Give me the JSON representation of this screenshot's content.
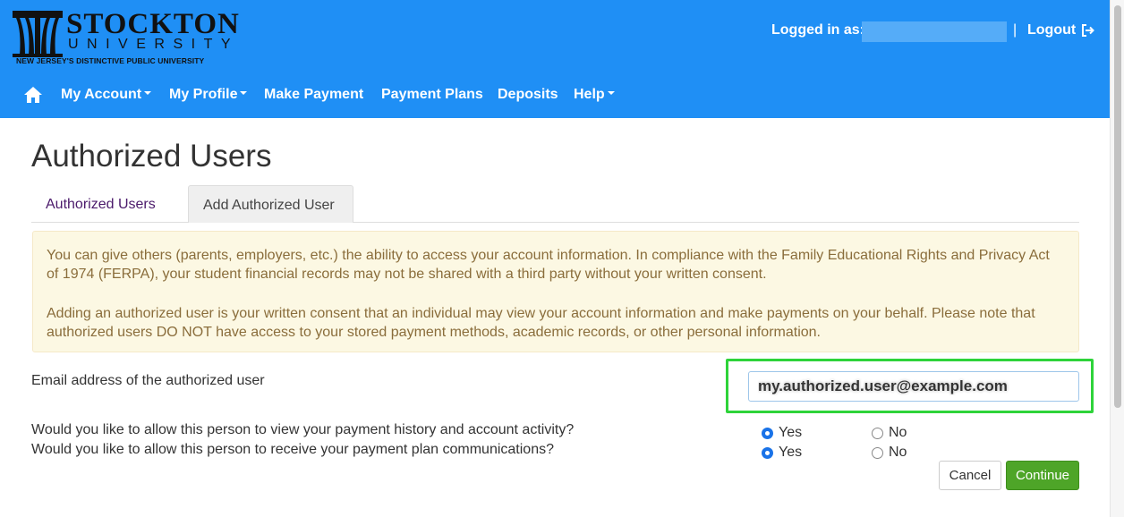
{
  "brand": {
    "name": "STOCKTON",
    "sub": "UNIVERSITY",
    "tagline": "NEW JERSEY'S DISTINCTIVE PUBLIC UNIVERSITY"
  },
  "header": {
    "logged_in_label": "Logged in as:",
    "separator": "|",
    "logout_label": "Logout",
    "background_color": "#1f8ff5"
  },
  "nav": {
    "home_icon": "home-icon",
    "items": [
      {
        "label": "My Account",
        "has_dropdown": true
      },
      {
        "label": "My Profile",
        "has_dropdown": true
      },
      {
        "label": "Make Payment",
        "has_dropdown": false
      },
      {
        "label": "Payment Plans",
        "has_dropdown": false
      },
      {
        "label": "Deposits",
        "has_dropdown": false
      },
      {
        "label": "Help",
        "has_dropdown": true
      }
    ]
  },
  "page": {
    "title": "Authorized Users",
    "tabs": [
      {
        "label": "Authorized Users",
        "active": false
      },
      {
        "label": "Add Authorized User",
        "active": true
      }
    ],
    "notice": {
      "paragraph1": "You can give others (parents, employers, etc.) the ability to access your account information. In compliance with the Family Educational Rights and Privacy Act of 1974 (FERPA), your student financial records may not be shared with a third party without your written consent.",
      "paragraph2": "Adding an authorized user is your written consent that an individual may view your account information and make payments on your behalf. Please note that authorized users DO NOT have access to your stored payment methods, academic records, or other personal information."
    },
    "form": {
      "email_label": "Email address of the authorized user",
      "email_value": "my.authorized.user@example.com",
      "question1": "Would you like to allow this person to view your payment history and account activity?",
      "question2": "Would you like to allow this person to receive your payment plan communications?",
      "yes_label": "Yes",
      "no_label": "No",
      "q1_selected": "Yes",
      "q2_selected": "Yes",
      "highlight_color": "#2ed33a"
    },
    "buttons": {
      "cancel": "Cancel",
      "continue": "Continue",
      "continue_color": "#4ea528"
    }
  }
}
